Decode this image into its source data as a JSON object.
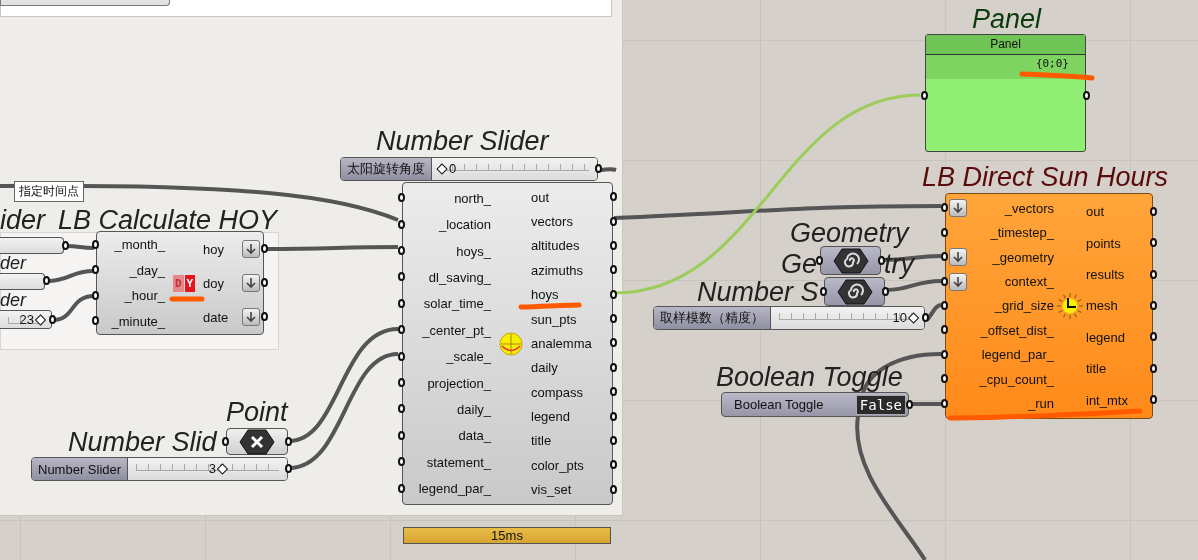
{
  "tooltip": "指定时间点",
  "cut_titles": [
    "ider",
    "der",
    "der"
  ],
  "cut_slider": {
    "value": "23",
    "level": 1
  },
  "hoy": {
    "title": "LB Calculate HOY",
    "icon": [
      "D",
      "Y"
    ],
    "inputs": [
      {
        "name": "_month_",
        "flatten": false
      },
      {
        "name": "_day_",
        "flatten": false
      },
      {
        "name": "_hour_",
        "flatten": false
      },
      {
        "name": "_minute_",
        "flatten": false
      }
    ],
    "outputs": [
      {
        "name": "hoy",
        "flatten": true
      },
      {
        "name": "doy",
        "flatten": true
      },
      {
        "name": "date",
        "flatten": true
      }
    ]
  },
  "angle_slider": {
    "title": "Number Slider",
    "label": "太阳旋转角度",
    "value": "0",
    "level": 0
  },
  "sunpath": {
    "inputs": [
      "north_",
      "_location",
      "hoys_",
      "dl_saving_",
      "solar_time_",
      "_center_pt_",
      "_scale_",
      "projection_",
      "daily_",
      "data_",
      "statement_",
      "legend_par_"
    ],
    "outputs": [
      "out",
      "vectors",
      "altitudes",
      "azimuths",
      "hoys",
      "sun_pts",
      "analemma",
      "daily",
      "compass",
      "legend",
      "title",
      "color_pts",
      "vis_set"
    ],
    "timer": "15ms"
  },
  "panel": {
    "title": "Panel",
    "header": "Panel",
    "content": "{0;0}"
  },
  "direct_sun": {
    "title": "LB Direct Sun Hours",
    "inputs": [
      {
        "name": "_vectors",
        "flatten": true
      },
      {
        "name": "_timestep_",
        "flatten": false
      },
      {
        "name": "_geometry",
        "flatten": true
      },
      {
        "name": "context_",
        "flatten": true
      },
      {
        "name": "_grid_size",
        "flatten": false
      },
      {
        "name": "_offset_dist_",
        "flatten": false
      },
      {
        "name": "legend_par_",
        "flatten": false
      },
      {
        "name": "_cpu_count_",
        "flatten": false
      },
      {
        "name": "_run",
        "flatten": false
      }
    ],
    "outputs": [
      "out",
      "points",
      "results",
      "mesh",
      "legend",
      "title",
      "int_mtx"
    ]
  },
  "geometry_params": [
    {
      "title": "Geometry"
    },
    {
      "title_parts": [
        "Ge",
        "try"
      ]
    }
  ],
  "grid_slider": {
    "title": "Number S",
    "label": "取样模数（精度）",
    "value": "10",
    "level": 1
  },
  "toggle": {
    "title": "Boolean Toggle",
    "label": "Boolean Toggle",
    "value": "False"
  },
  "point": {
    "title": "Point"
  },
  "count_slider": {
    "title": "Number Slid",
    "label": "Number Slider",
    "value": "3",
    "level": 0.58
  }
}
